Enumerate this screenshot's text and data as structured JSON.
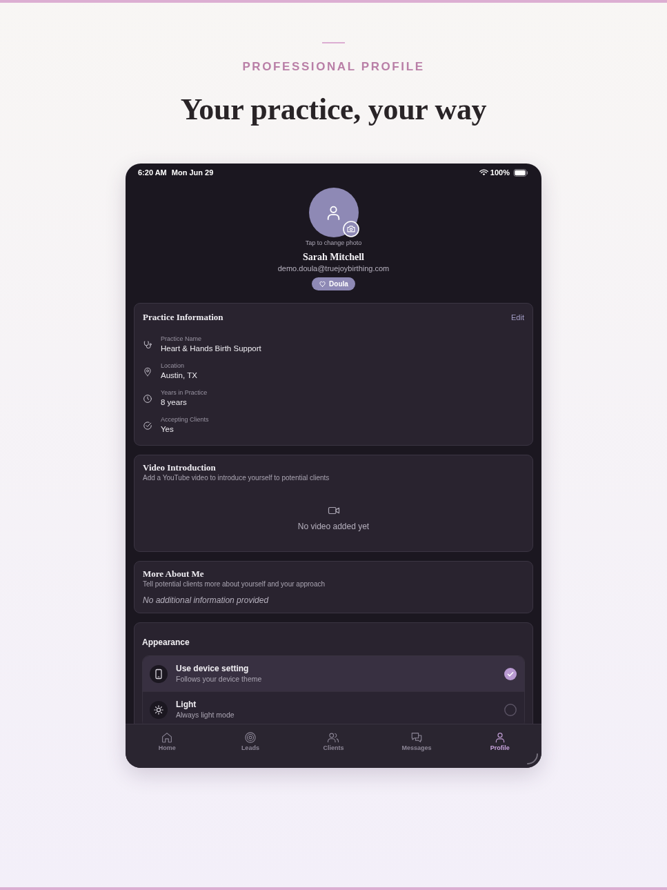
{
  "header": {
    "eyebrow": "PROFESSIONAL PROFILE",
    "title": "Your practice, your way"
  },
  "status_bar": {
    "time": "6:20 AM",
    "date": "Mon Jun 29",
    "battery": "100%"
  },
  "profile": {
    "photo_hint": "Tap to change photo",
    "name": "Sarah Mitchell",
    "email": "demo.doula@truejoybirthing.com",
    "role": "Doula"
  },
  "practice_information": {
    "title": "Practice Information",
    "action": "Edit",
    "fields": [
      {
        "kind": "stethoscope",
        "label": "Practice Name",
        "value": "Heart & Hands Birth Support"
      },
      {
        "kind": "location",
        "label": "Location",
        "value": "Austin, TX"
      },
      {
        "kind": "clock",
        "label": "Years in Practice",
        "value": "8 years"
      },
      {
        "kind": "check",
        "label": "Accepting Clients",
        "value": "Yes"
      }
    ]
  },
  "video_introduction": {
    "title": "Video Introduction",
    "subtitle": "Add a YouTube video to introduce yourself to potential clients",
    "empty_text": "No video added yet"
  },
  "more_about_me": {
    "title": "More About Me",
    "subtitle": "Tell potential clients more about yourself and your approach",
    "empty_text": "No additional information provided"
  },
  "appearance": {
    "title": "Appearance",
    "options": [
      {
        "kind": "device",
        "title": "Use device setting",
        "subtitle": "Follows your device theme",
        "selected": true
      },
      {
        "kind": "light",
        "title": "Light",
        "subtitle": "Always light mode",
        "selected": false
      }
    ]
  },
  "tab_bar": [
    {
      "kind": "home",
      "label": "Home",
      "selected": false
    },
    {
      "kind": "leads",
      "label": "Leads",
      "selected": false
    },
    {
      "kind": "clients",
      "label": "Clients",
      "selected": false
    },
    {
      "kind": "messages",
      "label": "Messages",
      "selected": false
    },
    {
      "kind": "profile",
      "label": "Profile",
      "selected": true
    }
  ]
}
